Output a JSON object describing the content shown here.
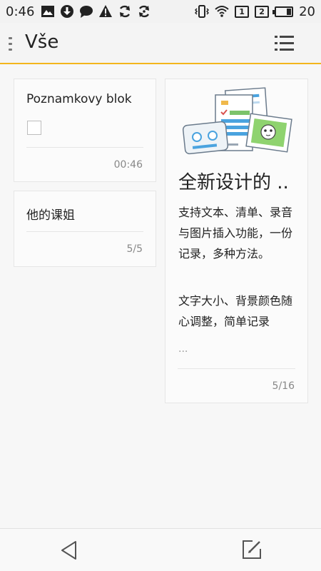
{
  "status_bar": {
    "time": "0:46",
    "sim1": "1",
    "sim2": "2",
    "battery": "20",
    "icons": [
      "image-icon",
      "download-icon",
      "chat-icon",
      "warning-icon",
      "sync-icon",
      "sync-icon",
      "vibrate-icon",
      "wifi-icon"
    ]
  },
  "app_bar": {
    "title": "Vše"
  },
  "notes": [
    {
      "title": "Poznamkovy blok",
      "has_checkbox": true,
      "meta": "00:46"
    },
    {
      "title": "他的课姐",
      "meta": "5/5"
    }
  ],
  "promo_note": {
    "title": "全新设计的 ..",
    "paragraph1": "支持文本、清单、录音与图片插入功能，一份记录，多种方法。",
    "paragraph2": "文字大小、背景颜色随心调整，简单记录",
    "ellipsis": "...",
    "meta": "5/16"
  },
  "colors": {
    "accent": "#f3b51c",
    "background": "#f7f7f7"
  }
}
